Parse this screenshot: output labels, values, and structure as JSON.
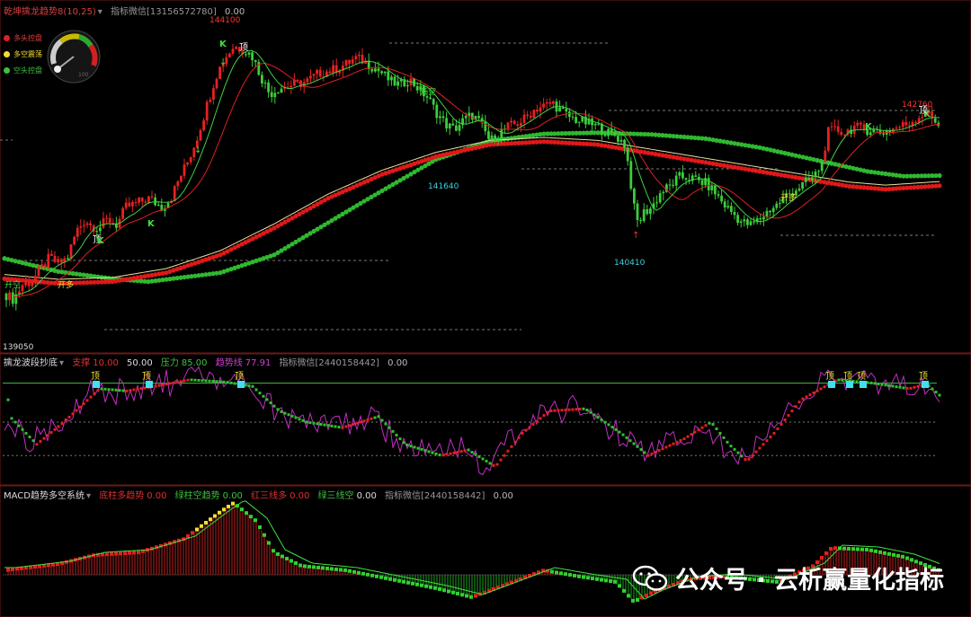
{
  "panels": {
    "main": {
      "indicator": "乾坤擒龙趋势8(10,25)",
      "value": "0.00",
      "contact": "指标微信[13156572780]",
      "legend": [
        {
          "label": "多头控盘",
          "color": "#e02020"
        },
        {
          "label": "多空震荡",
          "color": "#f0e030"
        },
        {
          "label": "空头控盘",
          "color": "#40c040"
        }
      ],
      "gauge_max": "100",
      "price_labels": {
        "high": "144100",
        "mid": "141640",
        "low": "140410",
        "right_high": "142760",
        "left_low": "139050"
      },
      "signal_labels": {
        "top": "顶",
        "k": "K",
        "open_long": "开多",
        "open_short": "开空"
      }
    },
    "osc": {
      "indicator": "擒龙波段抄底",
      "support_label": "支撑",
      "support_value": "10.00",
      "mid_value": "50.00",
      "pressure_label": "压力",
      "pressure_value": "85.00",
      "trend_label": "趋势线",
      "trend_value": "77.91",
      "contact": "指标微信[2440158442]",
      "value": "0.00",
      "top_label": "顶"
    },
    "macd": {
      "indicator": "MACD趋势多空系统",
      "red_label": "底柱多趋势",
      "red_value": "0.00",
      "green_label": "绿柱空趋势",
      "green_value": "0.00",
      "red3_label": "红三线多",
      "red3_value": "0.00",
      "green3_label": "绿三线空",
      "green3_value": "0.00",
      "contact": "指标微信[2440158442]",
      "value": "0.00"
    }
  },
  "watermark": "公众号 · 云析赢量化指标",
  "chart_data": {
    "type": "candlestick",
    "ylim": [
      138950,
      144450
    ],
    "close_path": [
      [
        0,
        139750
      ],
      [
        10,
        139650
      ],
      [
        20,
        139900
      ],
      [
        30,
        139950
      ],
      [
        40,
        140150
      ],
      [
        50,
        140350
      ],
      [
        60,
        140250
      ],
      [
        70,
        140350
      ],
      [
        80,
        140800
      ],
      [
        90,
        141000
      ],
      [
        95,
        140900
      ],
      [
        105,
        140850
      ],
      [
        115,
        141000
      ],
      [
        125,
        140900
      ],
      [
        135,
        141200
      ],
      [
        145,
        141250
      ],
      [
        160,
        141350
      ],
      [
        175,
        141200
      ],
      [
        185,
        141350
      ],
      [
        195,
        141700
      ],
      [
        205,
        142000
      ],
      [
        215,
        142400
      ],
      [
        225,
        142900
      ],
      [
        235,
        143400
      ],
      [
        245,
        143700
      ],
      [
        255,
        143900
      ],
      [
        265,
        143850
      ],
      [
        275,
        143750
      ],
      [
        285,
        143400
      ],
      [
        295,
        143100
      ],
      [
        305,
        143200
      ],
      [
        320,
        143250
      ],
      [
        335,
        143300
      ],
      [
        350,
        143450
      ],
      [
        365,
        143500
      ],
      [
        380,
        143600
      ],
      [
        390,
        143700
      ],
      [
        400,
        143650
      ],
      [
        410,
        143550
      ],
      [
        420,
        143450
      ],
      [
        430,
        143300
      ],
      [
        440,
        143250
      ],
      [
        450,
        143350
      ],
      [
        460,
        143200
      ],
      [
        470,
        143050
      ],
      [
        480,
        142800
      ],
      [
        490,
        142600
      ],
      [
        500,
        142500
      ],
      [
        510,
        142650
      ],
      [
        520,
        142750
      ],
      [
        530,
        142600
      ],
      [
        540,
        142300
      ],
      [
        550,
        142450
      ],
      [
        560,
        142550
      ],
      [
        570,
        142600
      ],
      [
        580,
        142700
      ],
      [
        590,
        142850
      ],
      [
        600,
        142900
      ],
      [
        610,
        142950
      ],
      [
        620,
        142800
      ],
      [
        630,
        142700
      ],
      [
        640,
        142650
      ],
      [
        650,
        142600
      ],
      [
        660,
        142550
      ],
      [
        670,
        142450
      ],
      [
        680,
        142400
      ],
      [
        690,
        142250
      ],
      [
        695,
        141800
      ],
      [
        700,
        141200
      ],
      [
        705,
        140900
      ],
      [
        710,
        141100
      ],
      [
        720,
        141200
      ],
      [
        730,
        141450
      ],
      [
        740,
        141550
      ],
      [
        750,
        141700
      ],
      [
        760,
        141700
      ],
      [
        770,
        141650
      ],
      [
        780,
        141600
      ],
      [
        790,
        141450
      ],
      [
        800,
        141250
      ],
      [
        810,
        141100
      ],
      [
        820,
        140950
      ],
      [
        830,
        140900
      ],
      [
        840,
        141000
      ],
      [
        850,
        141150
      ],
      [
        860,
        141250
      ],
      [
        870,
        141400
      ],
      [
        880,
        141500
      ],
      [
        890,
        141600
      ],
      [
        900,
        141700
      ],
      [
        910,
        141950
      ],
      [
        915,
        142450
      ],
      [
        925,
        142500
      ],
      [
        935,
        142450
      ],
      [
        945,
        142550
      ],
      [
        955,
        142500
      ],
      [
        965,
        142500
      ],
      [
        975,
        142450
      ],
      [
        985,
        142500
      ],
      [
        995,
        142550
      ],
      [
        1005,
        142600
      ],
      [
        1015,
        142700
      ],
      [
        1020,
        142750
      ],
      [
        1025,
        142800
      ],
      [
        1030,
        142700
      ],
      [
        1035,
        142650
      ],
      [
        1040,
        142600
      ]
    ],
    "ma_long_red": [
      [
        0,
        140000
      ],
      [
        60,
        139920
      ],
      [
        120,
        139950
      ],
      [
        180,
        140100
      ],
      [
        240,
        140400
      ],
      [
        300,
        140850
      ],
      [
        360,
        141350
      ],
      [
        420,
        141750
      ],
      [
        480,
        142050
      ],
      [
        540,
        142250
      ],
      [
        600,
        142300
      ],
      [
        660,
        142250
      ],
      [
        720,
        142100
      ],
      [
        780,
        141950
      ],
      [
        840,
        141800
      ],
      [
        900,
        141650
      ],
      [
        940,
        141550
      ],
      [
        980,
        141500
      ],
      [
        1040,
        141560
      ]
    ],
    "ma_long_green": [
      [
        0,
        140340
      ],
      [
        60,
        140120
      ],
      [
        120,
        140000
      ],
      [
        160,
        139950
      ],
      [
        240,
        140100
      ],
      [
        300,
        140400
      ],
      [
        400,
        141300
      ],
      [
        480,
        142000
      ],
      [
        540,
        142310
      ],
      [
        600,
        142430
      ],
      [
        660,
        142450
      ],
      [
        720,
        142420
      ],
      [
        780,
        142350
      ],
      [
        840,
        142200
      ],
      [
        900,
        142000
      ],
      [
        960,
        141800
      ],
      [
        1000,
        141720
      ],
      [
        1040,
        141730
      ]
    ],
    "y_ticks": [
      139050,
      140410,
      141640,
      142760,
      144100
    ]
  }
}
